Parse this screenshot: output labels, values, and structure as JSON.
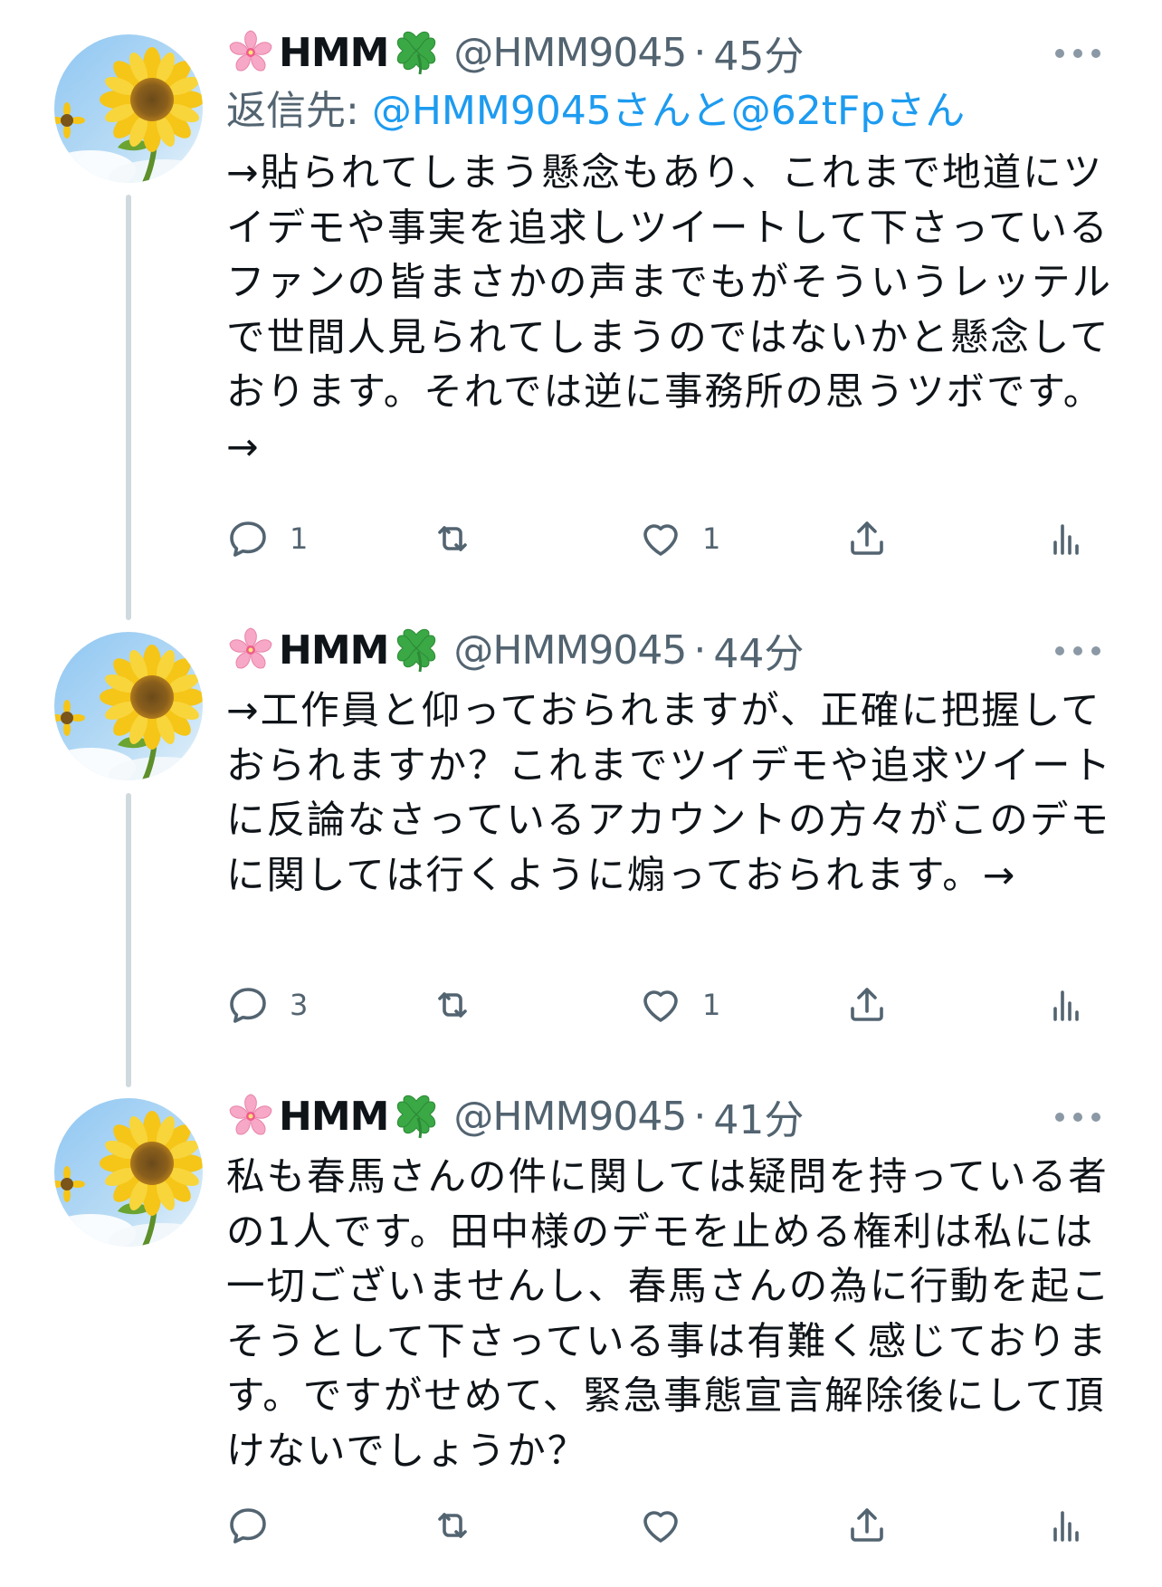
{
  "tweets": [
    {
      "name": "HMM",
      "handle": "@HMM9045",
      "time": "45分",
      "reply_prefix": "返信先: ",
      "reply_link": "@HMM9045さんと@62tFpさん",
      "text": "→貼られてしまう懸念もあり、これまで地道にツイデモや事実を追求しツイートして下さっているファンの皆まさかの声までもがそういうレッテルで世間人見られてしまうのではないかと懸念しております。それでは逆に事務所の思うツボです。→",
      "reply_count": "1",
      "retweet_count": "",
      "like_count": "1"
    },
    {
      "name": "HMM",
      "handle": "@HMM9045",
      "time": "44分",
      "text": "→工作員と仰っておられますが、正確に把握しておられますか？これまでツイデモや追求ツイートに反論なさっているアカウントの方々がこのデモに関しては行くように煽っておられます。→",
      "reply_count": "3",
      "retweet_count": "",
      "like_count": "1"
    },
    {
      "name": "HMM",
      "handle": "@HMM9045",
      "time": "41分",
      "text": "私も春馬さんの件に関しては疑問を持っている者の1人です。田中様のデモを止める権利は私には一切ございませんし、春馬さんの為に行動を起こそうとして下さっている事は有難く感じております。ですがせめて、緊急事態宣言解除後にして頂けないでしょうか？",
      "reply_count": "",
      "retweet_count": "",
      "like_count": ""
    }
  ],
  "separator": "·",
  "colors": {
    "link": "#1d9bf0",
    "secondary": "#536471",
    "thread_line": "#cfd9de"
  },
  "icons": {
    "name_prefix": "cherry-blossom-emoji",
    "name_suffix": "four-leaf-clover-emoji",
    "avatar": "sunflower-avatar",
    "actions": [
      "reply-icon",
      "retweet-icon",
      "like-icon",
      "share-icon",
      "analytics-icon"
    ]
  }
}
